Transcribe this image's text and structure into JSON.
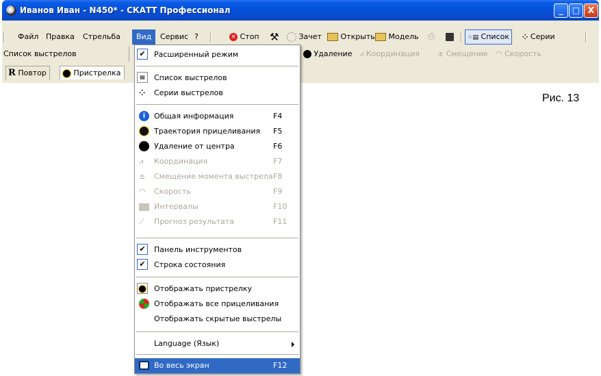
{
  "window": {
    "title": "Иванов Иван - N450* - СКАТТ Профессионал",
    "controls": {
      "minimize": "_",
      "maximize": "□",
      "close": "X"
    }
  },
  "menubar": {
    "items": [
      "Файл",
      "Правка",
      "Стрельба",
      "Вид",
      "Сервис",
      "?"
    ],
    "active": "Вид"
  },
  "toolbar": {
    "stop": "Стоп",
    "credit": "Зачет",
    "open": "Открыть",
    "model": "Модель",
    "list": "Список",
    "series": "Серии"
  },
  "panel": {
    "title": "Список выстрелов"
  },
  "toolbar2": {
    "distance": "Удаление",
    "coordination": "Координация",
    "offset": "Смещение",
    "speed": "Скорость"
  },
  "tabs": {
    "repeat": "Повтор",
    "sighting": "Пристрелка"
  },
  "figure_caption": "Рис. 13",
  "menu": {
    "extended_mode": "Расширенный режим",
    "shot_list": "Список выстрелов",
    "shot_series": "Серии выстрелов",
    "general_info": {
      "label": "Общая информация",
      "key": "F4"
    },
    "aiming_trajectory": {
      "label": "Траектория прицеливания",
      "key": "F5"
    },
    "distance_from_center": {
      "label": "Удаление от центра",
      "key": "F6"
    },
    "coordination": {
      "label": "Координация",
      "key": "F7"
    },
    "shot_offset": {
      "label": "Смещение момента выстрела",
      "key": "F8"
    },
    "speed": {
      "label": "Скорость",
      "key": "F9"
    },
    "intervals": {
      "label": "Интервалы",
      "key": "F10"
    },
    "forecast": {
      "label": "Прогноз результата",
      "key": "F11"
    },
    "toolbar_panel": "Панель инструментов",
    "status_bar": "Строка состояния",
    "show_sighting": "Отображать пристрелку",
    "show_all_aiming": "Отображать все прицеливания",
    "show_hidden_shots": "Отображать скрытые выстрелы",
    "language": "Language (Язык)",
    "full_screen": {
      "label": "Во весь экран",
      "key": "F12"
    }
  },
  "colors": {
    "titlebar": "#0550d8",
    "highlight": "#316ac5",
    "face": "#ece9d8",
    "disabled": "#aca899"
  }
}
